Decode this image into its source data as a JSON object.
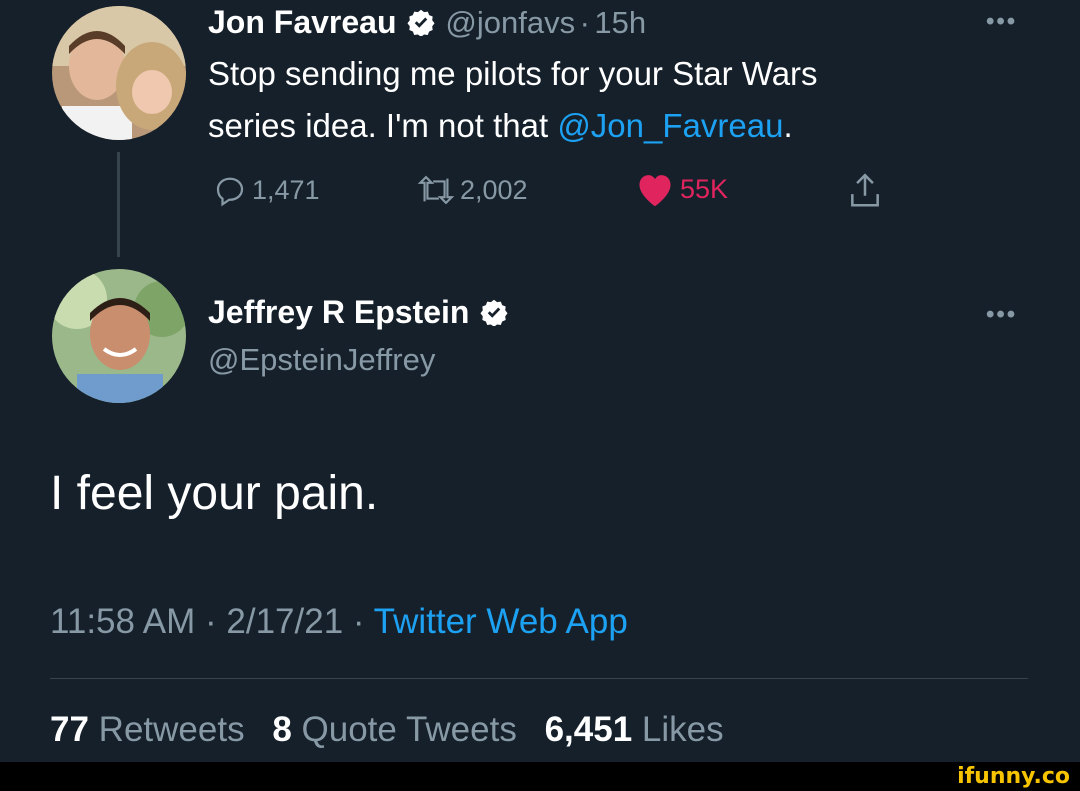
{
  "parent_tweet": {
    "name": "Jon Favreau",
    "handle": "@jonfavs",
    "separator": "·",
    "time": "15h",
    "text_line1": "Stop sending me pilots for your Star Wars",
    "text_line2_prefix": "series idea. I'm not that ",
    "mention": "@Jon_Favreau",
    "text_line2_suffix": ".",
    "actions": {
      "replies": "1,471",
      "retweets": "2,002",
      "likes": "55K"
    },
    "icons": [
      "verified-badge-icon",
      "reply-icon",
      "retweet-icon",
      "heart-icon",
      "share-icon",
      "more-icon"
    ]
  },
  "reply_tweet": {
    "name": "Jeffrey R Epstein",
    "handle": "@EpsteinJeffrey",
    "text": "I feel your pain.",
    "timestamp": "11:58 AM · 2/17/21 · ",
    "source": "Twitter Web App",
    "stats": {
      "retweets_count": "77",
      "retweets_label": "Retweets",
      "quotes_count": "8",
      "quotes_label": "Quote Tweets",
      "likes_count": "6,451",
      "likes_label": "Likes"
    }
  },
  "more_label": "•••",
  "watermark": "ifunny.co",
  "colors": {
    "background": "#15202b",
    "accent": "#1da1f2",
    "secondary_text": "#8899a6",
    "like": "#e0245e"
  }
}
